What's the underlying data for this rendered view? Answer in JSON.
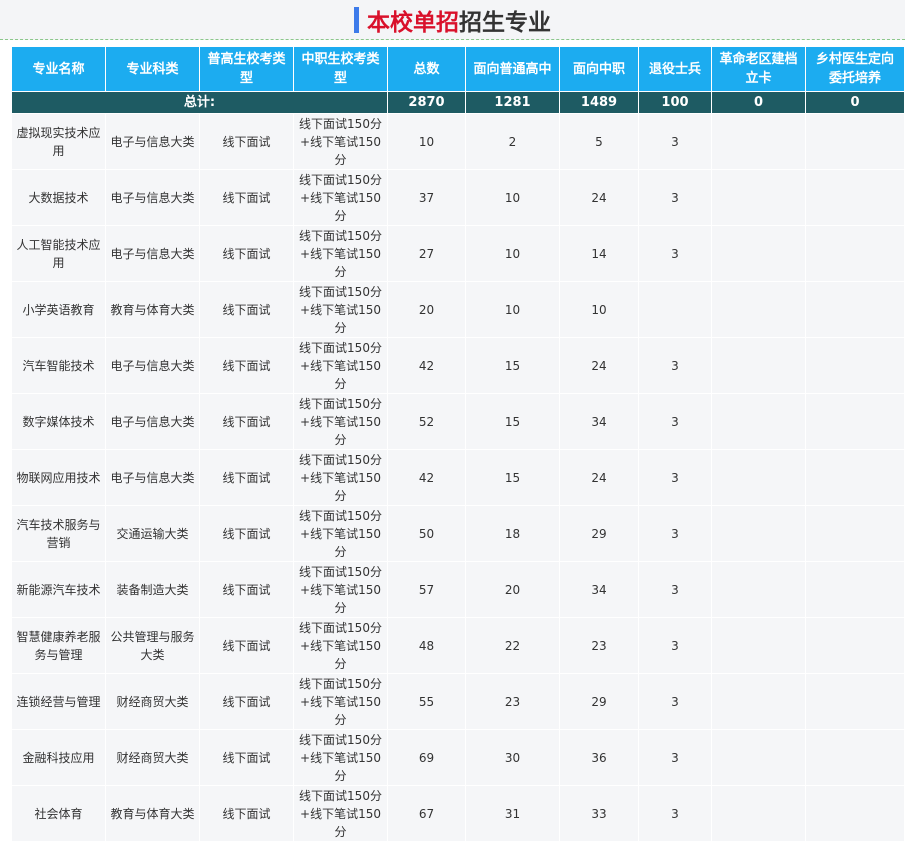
{
  "page": {
    "title_highlight": "本校单招",
    "title_rest": "招生专业"
  },
  "table": {
    "headers": [
      "专业名称",
      "专业科类",
      "普高生校考类型",
      "中职生校考类型",
      "总数",
      "面向普通高中",
      "面向中职",
      "退役士兵",
      "革命老区建档立卡",
      "乡村医生定向委托培养"
    ],
    "total": {
      "label": "总计:",
      "values": [
        "2870",
        "1281",
        "1489",
        "100",
        "0",
        "0"
      ]
    },
    "rows": [
      [
        "虚拟现实技术应用",
        "电子与信息大类",
        "线下面试",
        "线下面试150分+线下笔试150分",
        "10",
        "2",
        "5",
        "3",
        "",
        ""
      ],
      [
        "大数据技术",
        "电子与信息大类",
        "线下面试",
        "线下面试150分+线下笔试150分",
        "37",
        "10",
        "24",
        "3",
        "",
        ""
      ],
      [
        "人工智能技术应用",
        "电子与信息大类",
        "线下面试",
        "线下面试150分+线下笔试150分",
        "27",
        "10",
        "14",
        "3",
        "",
        ""
      ],
      [
        "小学英语教育",
        "教育与体育大类",
        "线下面试",
        "线下面试150分+线下笔试150分",
        "20",
        "10",
        "10",
        "",
        "",
        ""
      ],
      [
        "汽车智能技术",
        "电子与信息大类",
        "线下面试",
        "线下面试150分+线下笔试150分",
        "42",
        "15",
        "24",
        "3",
        "",
        ""
      ],
      [
        "数字媒体技术",
        "电子与信息大类",
        "线下面试",
        "线下面试150分+线下笔试150分",
        "52",
        "15",
        "34",
        "3",
        "",
        ""
      ],
      [
        "物联网应用技术",
        "电子与信息大类",
        "线下面试",
        "线下面试150分+线下笔试150分",
        "42",
        "15",
        "24",
        "3",
        "",
        ""
      ],
      [
        "汽车技术服务与营销",
        "交通运输大类",
        "线下面试",
        "线下面试150分+线下笔试150分",
        "50",
        "18",
        "29",
        "3",
        "",
        ""
      ],
      [
        "新能源汽车技术",
        "装备制造大类",
        "线下面试",
        "线下面试150分+线下笔试150分",
        "57",
        "20",
        "34",
        "3",
        "",
        ""
      ],
      [
        "智慧健康养老服务与管理",
        "公共管理与服务大类",
        "线下面试",
        "线下面试150分+线下笔试150分",
        "48",
        "22",
        "23",
        "3",
        "",
        ""
      ],
      [
        "连锁经营与管理",
        "财经商贸大类",
        "线下面试",
        "线下面试150分+线下笔试150分",
        "55",
        "23",
        "29",
        "3",
        "",
        ""
      ],
      [
        "金融科技应用",
        "财经商贸大类",
        "线下面试",
        "线下面试150分+线下笔试150分",
        "69",
        "30",
        "36",
        "3",
        "",
        ""
      ],
      [
        "社会体育",
        "教育与体育大类",
        "线下面试",
        "线下面试150分+线下笔试150分",
        "67",
        "31",
        "33",
        "3",
        "",
        ""
      ]
    ]
  }
}
